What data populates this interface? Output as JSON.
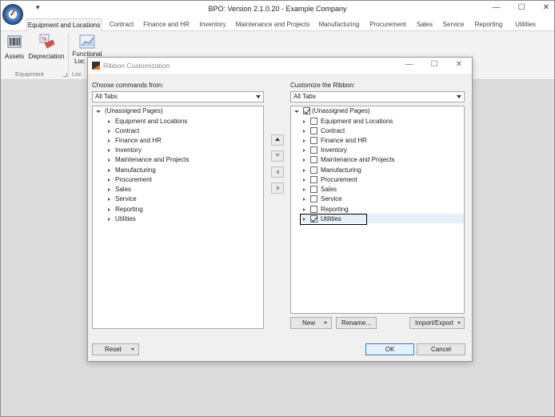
{
  "window": {
    "title": "BPO: Version 2.1.0.20 - Example Company",
    "qat_glyph": "▾",
    "controls": [
      "—",
      "☐",
      "✕"
    ]
  },
  "ribbon": {
    "tabs": [
      "Equipment and Locations",
      "Contract",
      "Finance and HR",
      "Inventory",
      "Maintenance and Projects",
      "Manufacturing",
      "Procurement",
      "Sales",
      "Service",
      "Reporting",
      "Utilities"
    ],
    "active_tab": "Equipment and Locations",
    "buttons": {
      "assets": "Assets",
      "depreciation": "Depreciation",
      "functional_line1": "Functional",
      "functional_line2": "Loc"
    },
    "groups": {
      "equipment": "Equipment",
      "loc": "Loc"
    },
    "colors": {
      "tab_bg": "#f3f3f3",
      "workspace": "#dcdcdc"
    }
  },
  "dialog": {
    "title": "Ribbon Customization",
    "controls": [
      "—",
      "☐",
      "✕"
    ],
    "left": {
      "label": "Choose commands from:",
      "combo_value": "All Tabs",
      "root": "(Unassigned Pages)",
      "items": [
        "Equipment and Locations",
        "Contract",
        "Finance and HR",
        "Inventory",
        "Maintenance and Projects",
        "Manufacturing",
        "Procurement",
        "Sales",
        "Service",
        "Reporting",
        "Utilities"
      ]
    },
    "right": {
      "label": "Customize the Ribbon:",
      "combo_value": "All Tabs",
      "root": "(Unassigned Pages)",
      "root_checked": true,
      "items": [
        {
          "label": "Equipment and Locations",
          "checked": false
        },
        {
          "label": "Contract",
          "checked": false
        },
        {
          "label": "Finance and HR",
          "checked": false
        },
        {
          "label": "Inventory",
          "checked": false
        },
        {
          "label": "Maintenance and Projects",
          "checked": false
        },
        {
          "label": "Manufacturing",
          "checked": false
        },
        {
          "label": "Procurement",
          "checked": false
        },
        {
          "label": "Sales",
          "checked": false
        },
        {
          "label": "Service",
          "checked": false
        },
        {
          "label": "Reporting",
          "checked": false
        },
        {
          "label": "Utilities",
          "checked": true
        }
      ],
      "selected": "Utilities"
    },
    "buttons": {
      "new": "New",
      "rename": "Rename...",
      "import_export": "Import/Export",
      "reset": "Reset",
      "ok": "OK",
      "cancel": "Cancel"
    },
    "icons": {
      "move_up": "arrow-up-icon",
      "move_down": "arrow-down-icon",
      "remove": "arrow-left-icon",
      "add": "arrow-right-icon"
    }
  }
}
